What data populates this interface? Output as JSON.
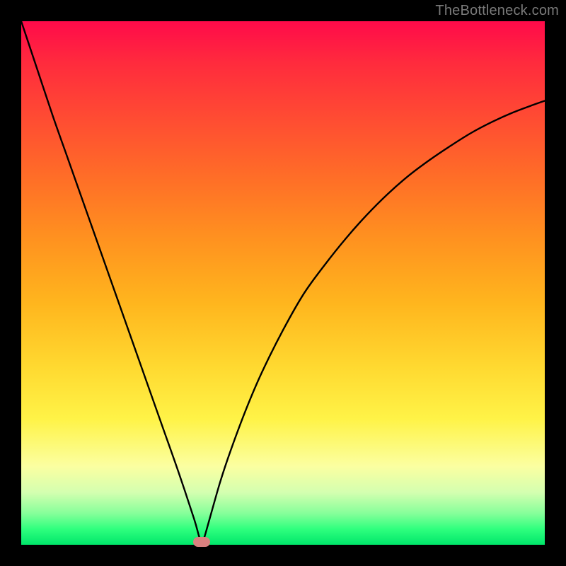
{
  "watermark": "TheBottleneck.com",
  "chart_data": {
    "type": "line",
    "title": "",
    "xlabel": "",
    "ylabel": "",
    "xlim": [
      0,
      100
    ],
    "ylim": [
      0,
      100
    ],
    "series": [
      {
        "name": "bottleneck-curve",
        "x": [
          0,
          3,
          6,
          9,
          12,
          15,
          18,
          21,
          24,
          27,
          30,
          33,
          34,
          34.5,
          35,
          36,
          38,
          40,
          43,
          46,
          50,
          54,
          58,
          62,
          66,
          70,
          74,
          78,
          82,
          86,
          90,
          94,
          98,
          100
        ],
        "y": [
          100,
          91,
          82,
          73.5,
          65,
          56.5,
          48,
          39.5,
          31,
          22.5,
          14,
          5,
          1.5,
          0.5,
          1.5,
          5,
          12,
          18,
          26,
          33,
          41,
          48,
          53.5,
          58.5,
          63,
          67,
          70.5,
          73.5,
          76.2,
          78.7,
          80.8,
          82.6,
          84.1,
          84.8
        ]
      }
    ],
    "markers": [
      {
        "name": "optimal-point",
        "x": 34.5,
        "y": 0.5,
        "color": "#d9807f"
      }
    ],
    "gradient_bands": [
      "#ff0a4a",
      "#ff2b3d",
      "#ff4a33",
      "#ff6e27",
      "#ff931f",
      "#ffb61e",
      "#ffd930",
      "#fff347",
      "#fbffa1",
      "#d4ffb0",
      "#86ff9a",
      "#2fff7e",
      "#00e66a"
    ]
  }
}
